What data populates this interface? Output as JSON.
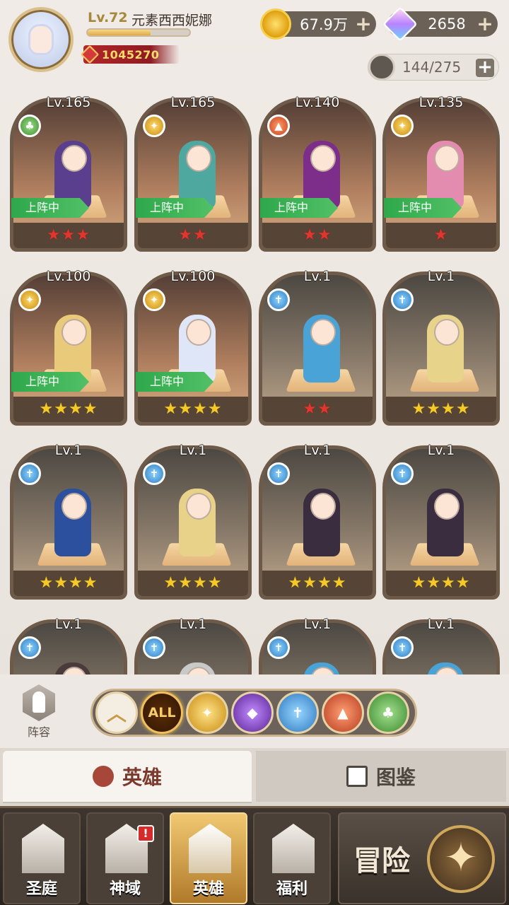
{
  "player": {
    "level": "Lv.72",
    "name": "元素西西妮娜",
    "power": "1045270",
    "exp_fraction": 0.62
  },
  "resources": {
    "gold": "67.9万",
    "diamonds": "2658",
    "hero_slots": "144/275"
  },
  "heroes": [
    {
      "level": "Lv.165",
      "faction": "nature",
      "stars": "★★★",
      "star_color": "red",
      "deployed": "上阵中"
    },
    {
      "level": "Lv.165",
      "faction": "light",
      "stars": "★★",
      "star_color": "red",
      "deployed": "上阵中"
    },
    {
      "level": "Lv.140",
      "faction": "fire",
      "stars": "★★",
      "star_color": "red",
      "deployed": "上阵中"
    },
    {
      "level": "Lv.135",
      "faction": "light",
      "stars": "★",
      "star_color": "red",
      "deployed": "上阵中"
    },
    {
      "level": "Lv.100",
      "faction": "light",
      "stars": "★★★★",
      "star_color": "gold",
      "deployed": "上阵中"
    },
    {
      "level": "Lv.100",
      "faction": "light",
      "stars": "★★★★",
      "star_color": "gold",
      "deployed": "上阵中"
    },
    {
      "level": "Lv.1",
      "faction": "water",
      "stars": "★★",
      "star_color": "red",
      "deployed": ""
    },
    {
      "level": "Lv.1",
      "faction": "water",
      "stars": "★★★★",
      "star_color": "gold",
      "deployed": ""
    },
    {
      "level": "Lv.1",
      "faction": "water",
      "stars": "★★★★",
      "star_color": "gold",
      "deployed": ""
    },
    {
      "level": "Lv.1",
      "faction": "water",
      "stars": "★★★★",
      "star_color": "gold",
      "deployed": ""
    },
    {
      "level": "Lv.1",
      "faction": "water",
      "stars": "★★★★",
      "star_color": "gold",
      "deployed": ""
    },
    {
      "level": "Lv.1",
      "faction": "water",
      "stars": "★★★★",
      "star_color": "gold",
      "deployed": ""
    },
    {
      "level": "Lv.1",
      "faction": "water",
      "stars": "",
      "star_color": "gold",
      "deployed": ""
    },
    {
      "level": "Lv.1",
      "faction": "water",
      "stars": "",
      "star_color": "gold",
      "deployed": ""
    },
    {
      "level": "Lv.1",
      "faction": "water",
      "stars": "",
      "star_color": "gold",
      "deployed": ""
    },
    {
      "level": "Lv.1",
      "faction": "water",
      "stars": "",
      "star_color": "gold",
      "deployed": ""
    }
  ],
  "filters": {
    "formation_label": "阵容",
    "items": [
      {
        "key": "collapse",
        "label": "︿"
      },
      {
        "key": "all",
        "label": "ALL"
      },
      {
        "key": "light",
        "label": ""
      },
      {
        "key": "dark",
        "label": ""
      },
      {
        "key": "water",
        "label": ""
      },
      {
        "key": "fire",
        "label": ""
      },
      {
        "key": "nature",
        "label": ""
      }
    ]
  },
  "tabs": {
    "heroes": "英雄",
    "codex": "图鉴"
  },
  "nav": {
    "sanctuary": "圣庭",
    "divine": "神域",
    "divine_alert": "!",
    "heroes": "英雄",
    "welfare": "福利",
    "adventure": "冒险"
  }
}
